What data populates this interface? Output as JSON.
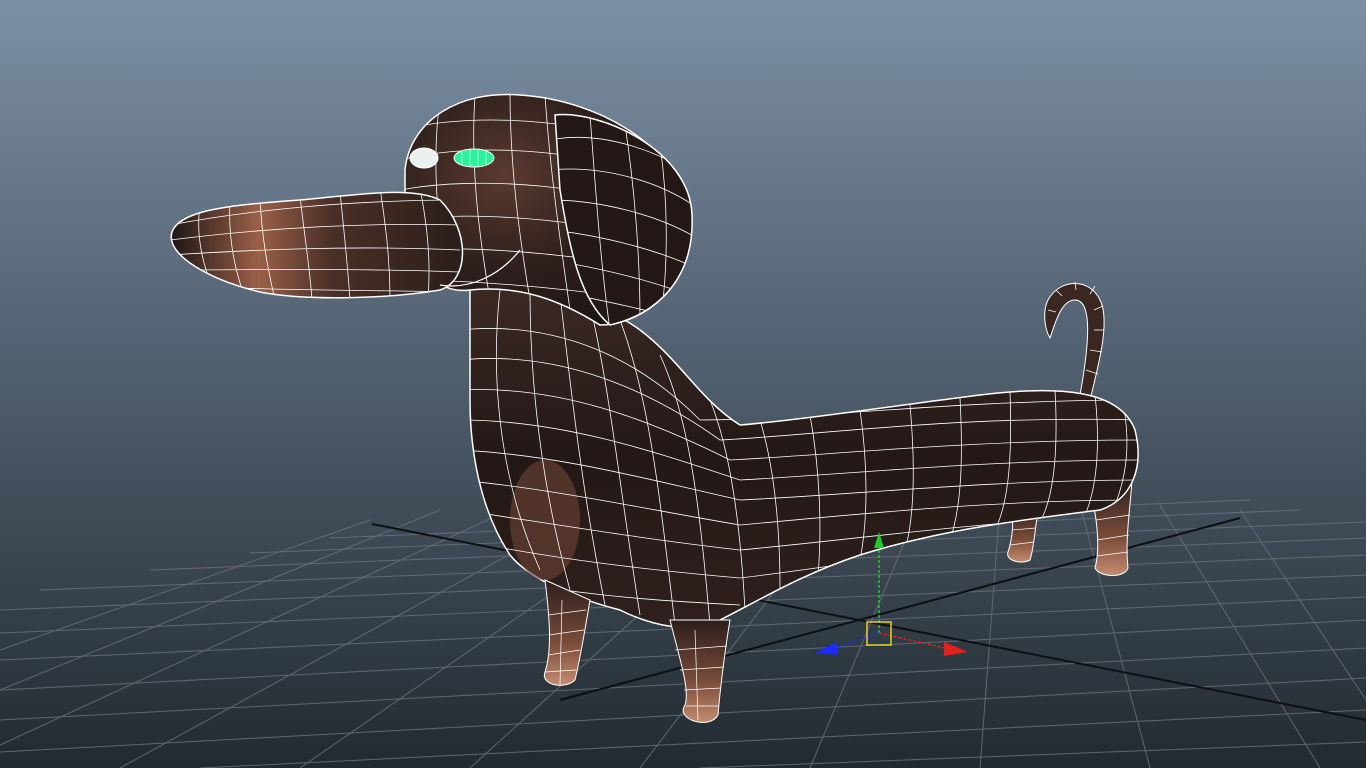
{
  "viewport": {
    "panel": "perspective-viewport",
    "display_mode": "smooth-shade-wireframe-on-shaded",
    "background_gradient": {
      "top": "#7c8fa5",
      "bottom": "#262d33"
    }
  },
  "model": {
    "subject": "dachshund",
    "body_color": "#2c1e1b",
    "highlight_color": "#8a5a44",
    "wire_color": "#ffffff",
    "eye_highlight_color": "#2cf29a"
  },
  "grid": {
    "line_color": "#6a7178",
    "axis_color": "#0d1012"
  },
  "manipulator": {
    "type": "move-tool",
    "x_axis_color": "#e0221f",
    "y_axis_color": "#1fcc2a",
    "z_axis_color": "#1a2bff",
    "center_color": "#e8d21c"
  }
}
